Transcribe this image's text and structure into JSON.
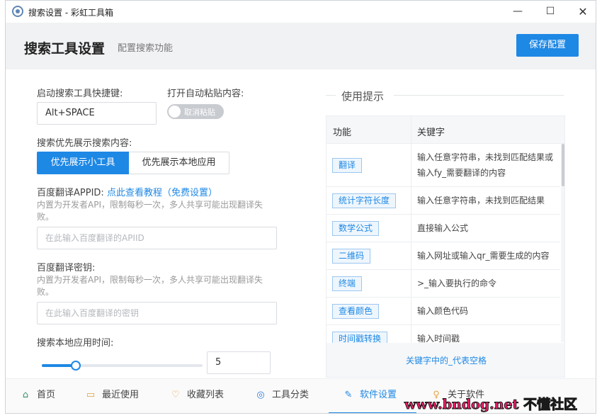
{
  "window": {
    "title": "搜索设置 - 彩虹工具箱",
    "minimize_glyph": "—",
    "maximize_glyph": "☐",
    "close_glyph": "✕"
  },
  "header": {
    "title": "搜索工具设置",
    "subtitle": "配置搜索功能",
    "save_label": "保存配置"
  },
  "form": {
    "shortcut": {
      "label": "启动搜索工具快捷键:",
      "value": "Alt+SPACE"
    },
    "autopaste": {
      "label": "打开自动粘贴内容:",
      "toggle_text": "取消粘贴",
      "enabled": false
    },
    "priority": {
      "label": "搜索优先展示搜索内容:",
      "options": [
        "优先展示小工具",
        "优先展示本地应用"
      ],
      "selected": "优先展示小工具"
    },
    "appid": {
      "label": "百度翻译APPID:",
      "link": "点此查看教程（免费设置）",
      "hint": "内置为开发者API，限制每秒一次，多人共享可能出现翻译失败。",
      "placeholder": "在此输入百度翻译的APIID"
    },
    "secret": {
      "label": "百度翻译密钥:",
      "hint": "内置为开发者API，限制每秒一次，多人共享可能出现翻译失败。",
      "placeholder": "在此输入百度翻译的密钥"
    },
    "search_time": {
      "label": "搜索本地应用时间:",
      "value": "5",
      "slider_fraction": 0.21
    }
  },
  "tips": {
    "title": "使用提示",
    "columns": [
      "功能",
      "关键字"
    ],
    "rows": [
      {
        "feature": "翻译",
        "keyword": "输入任意字符串，未找到匹配结果或输入fy_需要翻译的内容"
      },
      {
        "feature": "统计字符长度",
        "keyword": "输入任意字符串，未找到匹配结果"
      },
      {
        "feature": "数学公式",
        "keyword": "直接输入公式"
      },
      {
        "feature": "二维码",
        "keyword": "输入网址或输入qr_需要生成的内容"
      },
      {
        "feature": "终端",
        "keyword": ">_输入要执行的命令"
      },
      {
        "feature": "查看颜色",
        "keyword": "输入颜色代码"
      },
      {
        "feature": "时间戳转换",
        "keyword": "输入时间戳"
      }
    ],
    "footer": "关键字中的_代表空格"
  },
  "nav": {
    "items": [
      {
        "label": "首页",
        "icon": "⌂"
      },
      {
        "label": "最近使用",
        "icon": "▭"
      },
      {
        "label": "收藏列表",
        "icon": "♡"
      },
      {
        "label": "工具分类",
        "icon": "◎"
      },
      {
        "label": "软件设置",
        "icon": "✎"
      },
      {
        "label": "关于软件",
        "icon": "♀"
      }
    ],
    "active": "软件设置"
  },
  "watermark": "www.bndog.net 不懂社区",
  "colors": {
    "accent": "#1e88e5",
    "header_bg": "#f1f2f4",
    "watermark": "#ff1a6c"
  }
}
